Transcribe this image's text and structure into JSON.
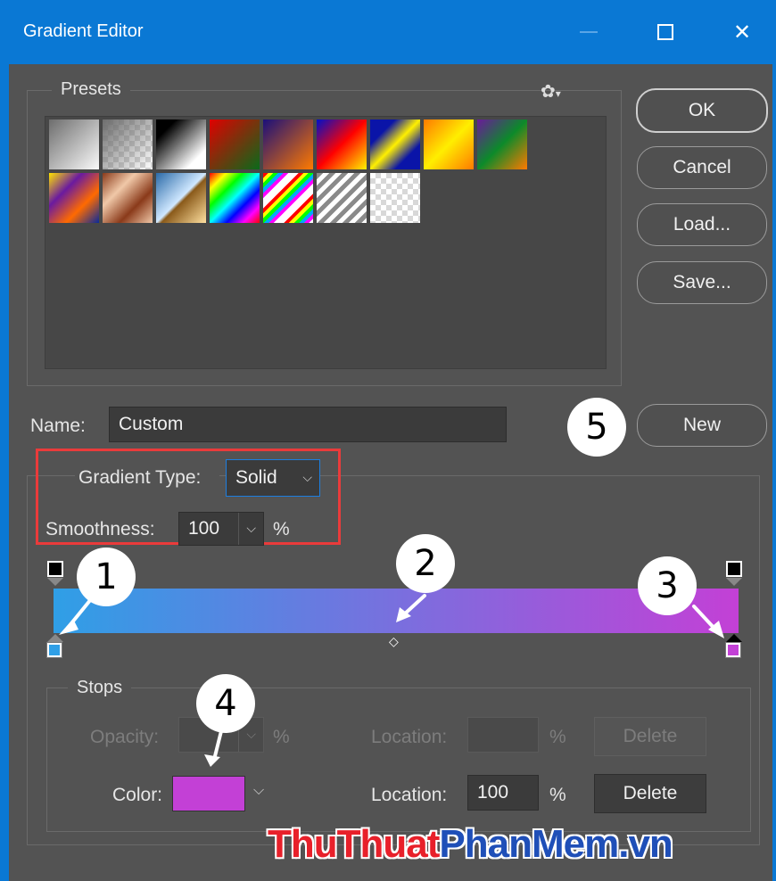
{
  "window": {
    "title": "Gradient Editor",
    "minimize_icon": "minimize-icon",
    "maximize_icon": "maximize-icon",
    "close_icon": "close-icon"
  },
  "presets": {
    "legend": "Presets",
    "settings_icon": "gear-icon",
    "swatches_row1": [
      "foreground-to-background",
      "foreground-to-transparent",
      "black-white",
      "red-green",
      "violet-orange",
      "blue-red-yellow",
      "blue-yellow-blue",
      "orange-yellow-orange",
      "violet-green-orange"
    ],
    "swatches_row2": [
      "yellow-violet-orange-blue",
      "copper",
      "chrome",
      "spectrum",
      "transparent-rainbow",
      "transparent-stripes",
      "transparent"
    ]
  },
  "buttons": {
    "ok": "OK",
    "cancel": "Cancel",
    "load": "Load...",
    "save": "Save...",
    "new": "New"
  },
  "name": {
    "label": "Name:",
    "value": "Custom"
  },
  "gradient": {
    "type_label": "Gradient Type:",
    "type_value": "Solid",
    "smoothness_label": "Smoothness:",
    "smoothness_value": "100",
    "smoothness_unit": "%",
    "start_color": "#2f9fe6",
    "end_color": "#c340d6"
  },
  "stops": {
    "legend": "Stops",
    "opacity_label": "Opacity:",
    "opacity_unit": "%",
    "opacity_location_label": "Location:",
    "opacity_location_unit": "%",
    "opacity_delete": "Delete",
    "color_label": "Color:",
    "color_value": "#c340d6",
    "color_location_label": "Location:",
    "color_location_value": "100",
    "color_location_unit": "%",
    "color_delete": "Delete"
  },
  "callouts": [
    "1",
    "2",
    "3",
    "4",
    "5"
  ],
  "watermark": {
    "part1": "ThuThuat",
    "part2": "PhanMem",
    "part3": ".vn"
  }
}
